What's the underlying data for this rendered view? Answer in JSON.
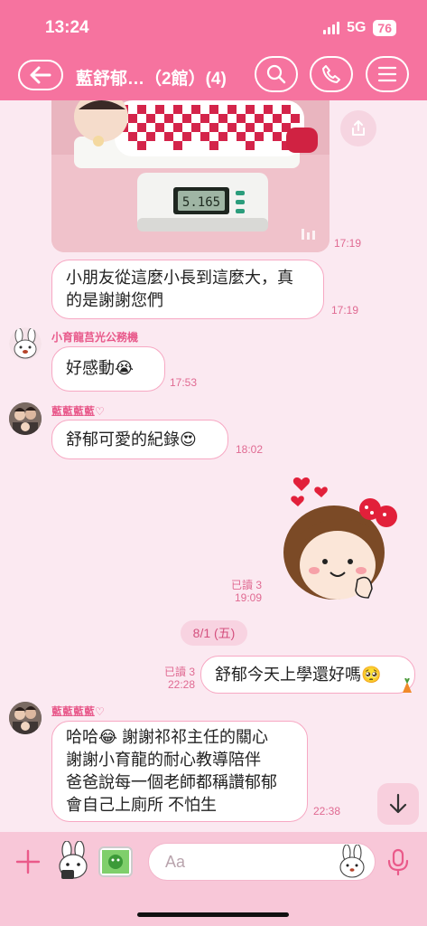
{
  "status": {
    "time": "13:24",
    "network": "5G",
    "battery": "76"
  },
  "header": {
    "title": "藍舒郁…（2館）(4)"
  },
  "messages": [
    {
      "time": "17:19"
    },
    {
      "text_line1": "小朋友從這麼小長到這麼大，真",
      "text_line2": "的是謝謝您們",
      "time": "17:19"
    },
    {
      "sender": "小育龍莒光公務機",
      "text": "好感動😭",
      "time": "17:53"
    },
    {
      "sender": "藍藍藍藍♡",
      "text": "舒郁可愛的紀錄😍",
      "time": "18:02"
    },
    {
      "read": "已讀 3",
      "time": "19:09"
    },
    {
      "read": "已讀 3",
      "text": "舒郁今天上學還好嗎🥺",
      "time": "22:28"
    },
    {
      "sender": "藍藍藍藍♡",
      "line1": "哈哈😂 謝謝祁祁主任的關心",
      "line2": "謝謝小育龍的耐心教導陪伴",
      "line3": "爸爸說每一個老師都稱讚郁郁",
      "line4": "會自己上廁所 不怕生",
      "time": "22:38"
    }
  ],
  "scale_display": "5.165",
  "date_separator": "8/1 (五)",
  "input": {
    "placeholder": "Aa"
  },
  "colors": {
    "accent": "#f6739f",
    "bubble_border": "#f7a8c3",
    "background": "#fbe9f1"
  }
}
